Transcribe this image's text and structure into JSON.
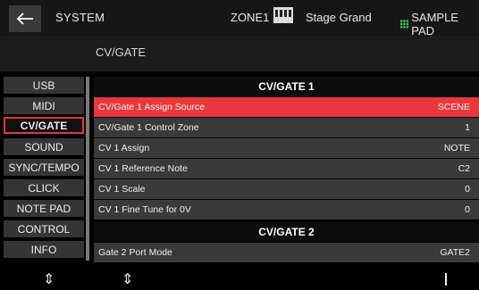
{
  "topbar": {
    "title": "SYSTEM",
    "zone": "ZONE1",
    "preset": "Stage Grand",
    "pad_mode": "SAMPLE PAD"
  },
  "page": {
    "title": "CV/GATE"
  },
  "sidebar": {
    "items": [
      {
        "label": "USB"
      },
      {
        "label": "MIDI"
      },
      {
        "label": "CV/GATE"
      },
      {
        "label": "SOUND"
      },
      {
        "label": "SYNC/TEMPO"
      },
      {
        "label": "CLICK"
      },
      {
        "label": "NOTE PAD"
      },
      {
        "label": "CONTROL"
      },
      {
        "label": "INFO"
      }
    ],
    "active": "CV/GATE"
  },
  "sections": [
    {
      "title": "CV/GATE 1"
    },
    {
      "title": "CV/GATE 2"
    }
  ],
  "rows": [
    {
      "label": "CV/Gate 1 Assign Source",
      "value": "SCENE"
    },
    {
      "label": "CV/Gate 1 Control Zone",
      "value": "1"
    },
    {
      "label": "CV 1 Assign",
      "value": "NOTE"
    },
    {
      "label": "CV 1 Reference Note",
      "value": "C2"
    },
    {
      "label": "CV 1 Scale",
      "value": "0"
    },
    {
      "label": "CV 1 Fine Tune for 0V",
      "value": "0"
    },
    {
      "label": "Gate 2 Port Mode",
      "value": "GATE2"
    }
  ],
  "bottom": {
    "arrow_glyph": "⇕"
  },
  "colors": {
    "accent": "#e8383d",
    "row_bg": "#3a3a3a",
    "sidebar_bg": "#353535"
  }
}
